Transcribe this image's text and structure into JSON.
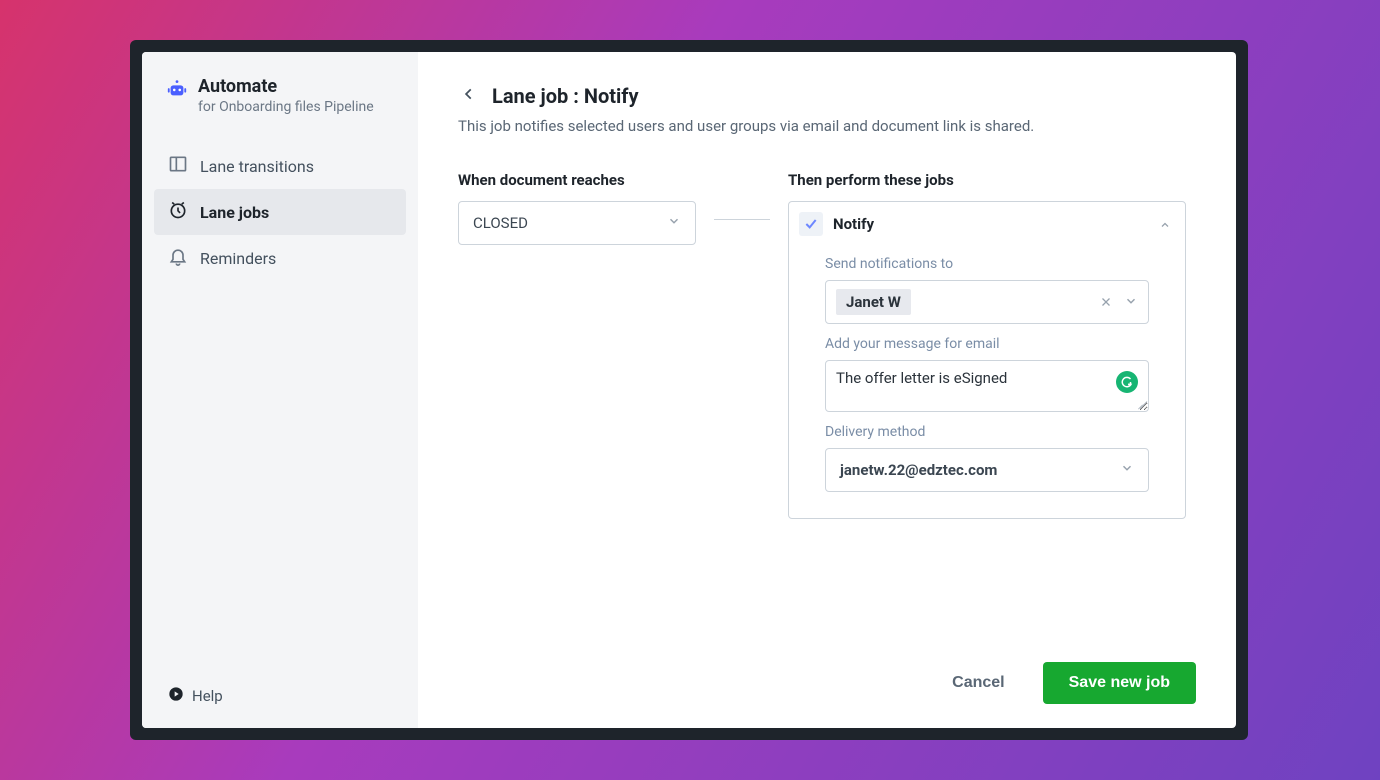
{
  "sidebar": {
    "title": "Automate",
    "subtitle": "for Onboarding files Pipeline",
    "items": [
      {
        "label": "Lane transitions",
        "icon": "layout"
      },
      {
        "label": "Lane jobs",
        "icon": "clock",
        "active": true
      },
      {
        "label": "Reminders",
        "icon": "bell"
      }
    ],
    "help_label": "Help"
  },
  "main": {
    "title": "Lane job : Notify",
    "description": "This job notifies selected users and user groups via email and document link is shared.",
    "when_label": "When document reaches",
    "then_label": "Then perform these jobs",
    "when_value": "CLOSED",
    "job": {
      "name": "Notify",
      "recipients_label": "Send notifications to",
      "recipient_tag": "Janet W",
      "message_label": "Add your message for email",
      "message_value": "The offer letter is eSigned",
      "delivery_label": "Delivery method",
      "delivery_value": "janetw.22@edztec.com"
    }
  },
  "footer": {
    "cancel": "Cancel",
    "save": "Save new job"
  }
}
